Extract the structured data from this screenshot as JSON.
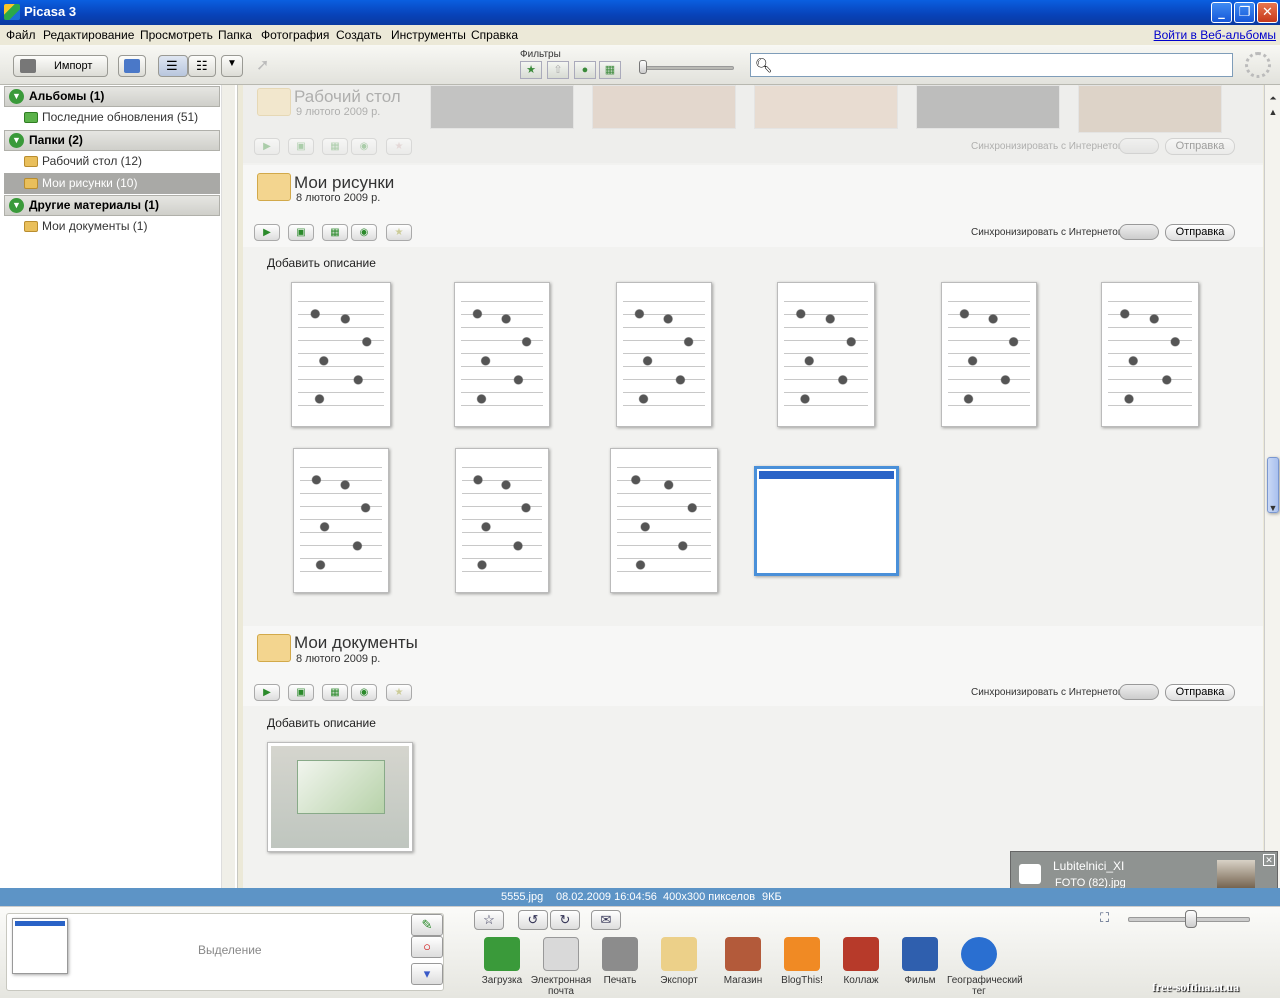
{
  "window": {
    "title": "Picasa 3"
  },
  "menubar": {
    "items": [
      "Файл",
      "Редактирование",
      "Просмотреть",
      "Папка",
      "Фотография",
      "Создать",
      "Инструменты",
      "Справка"
    ],
    "web_link": "Войти в Веб-альбомы"
  },
  "toolbar": {
    "import_label": "Импорт",
    "filters_label": "Фильтры",
    "search_placeholder": ""
  },
  "sidebar": {
    "sections": [
      {
        "label": "Альбомы (1)",
        "items": [
          {
            "label": "Последние обновления (51)",
            "selected": false
          }
        ]
      },
      {
        "label": "Папки (2)",
        "items": [
          {
            "label": "Рабочий стол (12)",
            "selected": false
          },
          {
            "label": "Мои рисунки (10)",
            "selected": true
          }
        ]
      },
      {
        "label": "Другие материалы (1)",
        "items": [
          {
            "label": "Мои документы (1)",
            "selected": false
          }
        ]
      }
    ]
  },
  "folders": [
    {
      "title": "Рабочий стол",
      "date": "9 лютого 2009 р.",
      "sync_label": "Синхронизировать с Интернетом",
      "send_label": "Отправка"
    },
    {
      "title": "Мои рисунки",
      "date": "8 лютого 2009 р.",
      "sync_label": "Синхронизировать с Интернетом",
      "send_label": "Отправка",
      "add_description": "Добавить описание"
    },
    {
      "title": "Мои документы",
      "date": "8 лютого 2009 р.",
      "sync_label": "Синхронизировать с Интернетом",
      "send_label": "Отправка",
      "add_description": "Добавить описание"
    }
  ],
  "notification": {
    "title": "Lubitelnici_XI",
    "subtitle": "FOTO (82).jpg"
  },
  "statusbar": {
    "filename": "5555.jpg",
    "datetime": "08.02.2009 16:04:56",
    "dimensions": "400x300 пикселов",
    "size": "9КБ"
  },
  "tray": {
    "selection_label": "Выделение",
    "actions": [
      "Загрузка",
      "Электронная почта",
      "Печать",
      "Экспорт",
      "Магазин",
      "BlogThis!",
      "Коллаж",
      "Фильм",
      "Географический тег"
    ]
  },
  "watermark": "free-softina.at.ua",
  "colors": {
    "titlebar": "#0a5fe0",
    "statusbar": "#5d94c6",
    "selected_item": "#a9a9a6",
    "accent_selection": "#4a90d9"
  }
}
